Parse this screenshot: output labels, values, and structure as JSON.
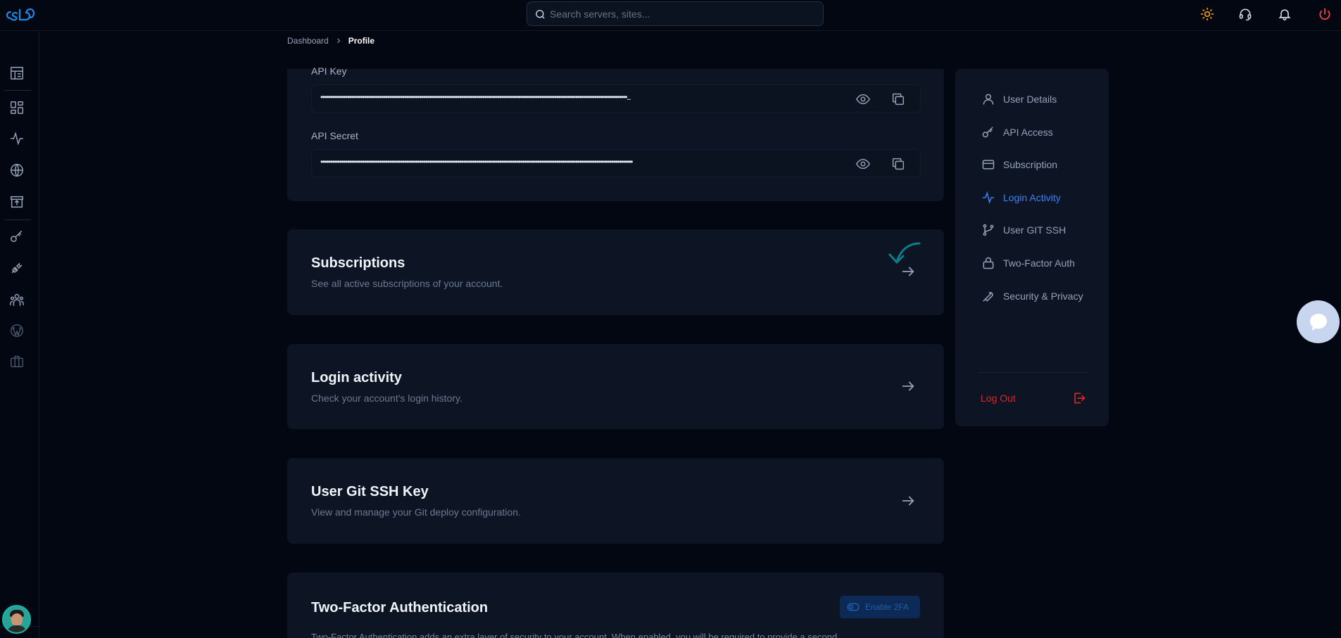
{
  "header": {
    "logo_icon": "cloudstick-logo",
    "search": {
      "placeholder": "Search servers, sites...",
      "value": ""
    },
    "icons": [
      "sun-icon",
      "headset-icon",
      "bell-icon",
      "power-icon"
    ]
  },
  "rail": {
    "icons": [
      "dashboard-grid-icon",
      "apps-icon",
      "activity-icon",
      "globe-icon",
      "store-icon",
      "key-icon",
      "plug-icon",
      "team-icon",
      "wordpress-icon",
      "briefcase-icon"
    ],
    "avatar_icon": "user-avatar"
  },
  "breadcrumb": {
    "root": "Dashboard",
    "current": "Profile"
  },
  "api": {
    "key_label": "API Key",
    "key_value": "•••••••••••••••••••••••••••••••••••••••••••••••••••••••••••••••••••••••••••••••••••••••••••••••••••••••••••••••••••••••••••••••••••••••••••••••••••••••••••••••••...",
    "secret_label": "API Secret",
    "secret_value": "••••••••••••••••••••••••••••••••••••••••••••••••••••••••••••••••••••••••••••••••••••••••••••••••••••••••••••••••••••••••••••••••••••••••••••••••••••••••••••••••••••"
  },
  "cards": {
    "subscriptions": {
      "title": "Subscriptions",
      "subtitle": "See all active subscriptions of your account."
    },
    "login_activity": {
      "title": "Login activity",
      "subtitle": "Check your account's login history."
    },
    "git_ssh": {
      "title": "User Git SSH Key",
      "subtitle": "View and manage your Git deploy configuration."
    },
    "two_factor": {
      "title": "Two-Factor Authentication",
      "button": "Enable 2FA",
      "body": "Two-Factor Authentication adds an extra layer of security to your account. When enabled, you will be required to provide a second"
    }
  },
  "sidenav": {
    "items": [
      {
        "label": "User Details",
        "icon": "user-icon"
      },
      {
        "label": "API Access",
        "icon": "key-icon"
      },
      {
        "label": "Subscription",
        "icon": "credit-card-icon"
      },
      {
        "label": "Login Activity",
        "icon": "activity-icon"
      },
      {
        "label": "User GIT SSH",
        "icon": "git-branch-icon"
      },
      {
        "label": "Two-Factor Auth",
        "icon": "lock-icon"
      },
      {
        "label": "Security & Privacy",
        "icon": "wrench-icon"
      }
    ],
    "active": "Login Activity",
    "logout": "Log Out"
  },
  "colors": {
    "background": "#030712",
    "card": "#0d1424",
    "accent": "#3b82f6",
    "danger": "#dc2626",
    "teal": "#14b8a6"
  }
}
